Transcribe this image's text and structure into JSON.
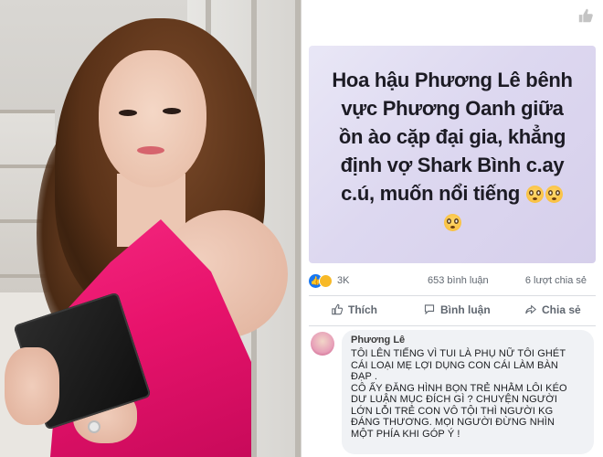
{
  "post": {
    "line1": "Hoa hậu Phương Lê bênh",
    "line2": "vực Phương Oanh giữa",
    "line3": "ồn ào cặp đại gia, khẳng",
    "line4": "định vợ Shark Bình c.ay",
    "line5": "c.ú, muốn nổi tiếng"
  },
  "stats": {
    "reactions": "3K",
    "comments": "653 bình luận",
    "shares": "6 lượt chia sẻ"
  },
  "actions": {
    "like": "Thích",
    "comment": "Bình luận",
    "share": "Chia sẻ"
  },
  "comment": {
    "author": "Phương Lê",
    "lines": [
      "TÔI LÊN TIẾNG VÌ TUI LÀ PHỤ NỮ TÔI GHÉT",
      "CÁI LOẠI MẸ LỢI DỤNG CON CÁI LÀM BÀN",
      "ĐẠP .",
      "CÔ ẤY ĐĂNG HÌNH BỌN TRẺ NHẰM LÔI KÉO",
      "DƯ LUẬN MỤC ĐÍCH GÌ ? CHUYỆN NGƯỜI",
      "LỚN LỖI TRẺ CON VÔ TỘI THÌ NGƯỜI KG",
      "ĐÁNG THƯƠNG. MỌI NGƯỜI ĐỪNG NHÌN",
      "MỘT PHÍA KHI GÓP Ý !"
    ]
  },
  "icons": {
    "like_corner": "thumbs-up-icon",
    "emoji": "flushed-face-emoji"
  },
  "colors": {
    "fb_blue": "#1877f2",
    "dress": "#e8136c",
    "post_bg": "#ddd8f0"
  }
}
